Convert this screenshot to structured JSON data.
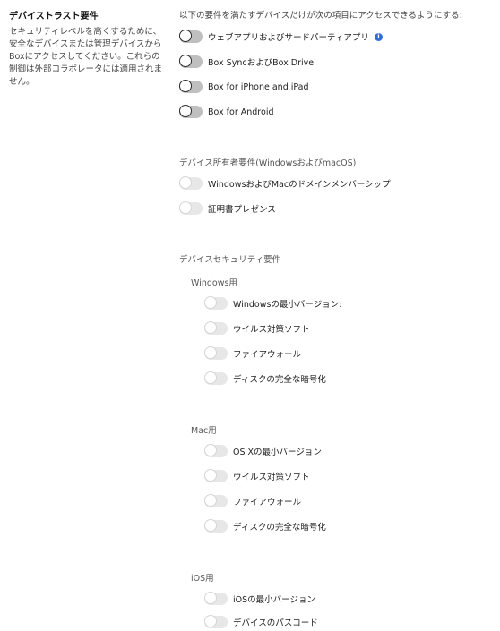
{
  "left": {
    "title": "デバイストラスト要件",
    "description": "セキュリティレベルを高くするために、安全なデバイスまたは管理デバイスからBoxにアクセスしてください。これらの制御は外部コラボレータには適用されません。"
  },
  "intro": "以下の要件を満たすデバイスだけが次の項目にアクセスできるようにする:",
  "access_items": [
    {
      "label": "ウェブアプリおよびサードパーティアプリ",
      "info_icon": "info-icon"
    },
    {
      "label": "Box SyncおよびBox Drive"
    },
    {
      "label": "Box for iPhone and iPad"
    },
    {
      "label": "Box for Android"
    }
  ],
  "owner_section": {
    "title": "デバイス所有者要件(WindowsおよびmacOS)",
    "items": [
      {
        "label": "WindowsおよびMacのドメインメンバーシップ"
      },
      {
        "label": "証明書プレゼンス"
      }
    ]
  },
  "security_section": {
    "title": "デバイスセキュリティ要件",
    "windows": {
      "label": "Windows用",
      "items": [
        {
          "label": "Windowsの最小バージョン:"
        },
        {
          "label": "ウイルス対策ソフト"
        },
        {
          "label": "ファイアウォール"
        },
        {
          "label": "ディスクの完全な暗号化"
        }
      ]
    },
    "mac": {
      "label": "Mac用",
      "items": [
        {
          "label": "OS Xの最小バージョン"
        },
        {
          "label": "ウイルス対策ソフト"
        },
        {
          "label": "ファイアウォール"
        },
        {
          "label": "ディスクの完全な暗号化"
        }
      ]
    },
    "ios": {
      "label": "iOS用",
      "items": [
        {
          "label": "iOSの最小バージョン"
        },
        {
          "label": "デバイスのパスコード"
        }
      ]
    }
  },
  "colors": {
    "info_icon": "#2f6fd6",
    "toggle_dark": "#bfbfbf",
    "toggle_light": "#e7e7e7"
  }
}
